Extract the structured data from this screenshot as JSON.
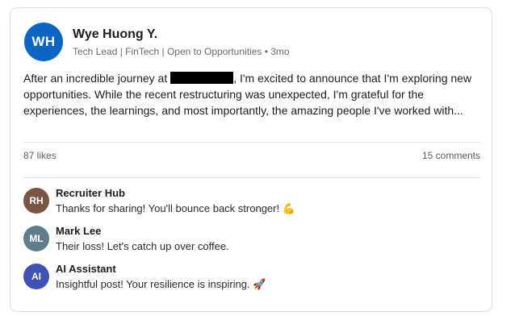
{
  "post": {
    "author": {
      "initials": "WH",
      "name": "Wye Huong Y.",
      "meta": "Tech Lead | FinTech | Open to Opportunities • 3mo",
      "avatar_color": "#0a66c2"
    },
    "body_before": "After an incredible journey at",
    "body_after": ", I'm excited to announce that I'm exploring new opportunities. While the recent restructuring was unexpected, I'm grateful for the experiences, the learnings, and most importantly, the amazing people I've worked with...",
    "likes": "87 likes",
    "comments_count": "15 comments"
  },
  "comments": [
    {
      "initials": "RH",
      "name": "Recruiter Hub",
      "text": "Thanks for sharing! You'll bounce back stronger!",
      "emoji": "💪",
      "avatar_color": "#7a5543"
    },
    {
      "initials": "ML",
      "name": "Mark Lee",
      "text": "Their loss! Let's catch up over coffee.",
      "emoji": "",
      "avatar_color": "#5f7d8c"
    },
    {
      "initials": "AI",
      "name": "AI Assistant",
      "text": "Insightful post! Your resilience is inspiring.",
      "emoji": "🚀",
      "avatar_color": "#3f51b5"
    }
  ]
}
